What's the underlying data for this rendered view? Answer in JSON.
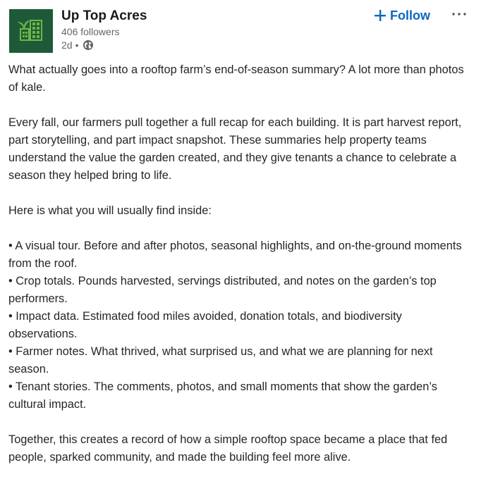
{
  "header": {
    "name": "Up Top Acres",
    "followers": "406 followers",
    "time": "2d",
    "dot": "•",
    "follow_label": "Follow",
    "more_label": "···",
    "logo_icon": "building-garden-logo-icon",
    "visibility_icon": "globe-icon",
    "colors": {
      "logo_bg": "#1e5a3a",
      "logo_fg": "#6fb643",
      "accent": "#0a66c2"
    }
  },
  "post": {
    "intro": "What actually goes into a rooftop farm’s end-of-season summary? A lot more than photos of kale.",
    "para2": "Every fall, our farmers pull together a full recap for each building. It is part harvest report, part storytelling, and part impact snapshot. These summaries help property teams understand the value the garden created, and they give tenants a chance to celebrate a season they helped bring to life.",
    "list_intro": "Here is what you will usually find inside:",
    "bullets": [
      "• A visual tour. Before and after photos, seasonal highlights, and on-the-ground moments from the roof.",
      "• Crop totals. Pounds harvested, servings distributed, and notes on the garden’s top performers.",
      "• Impact data. Estimated food miles avoided, donation totals, and biodiversity observations.",
      "• Farmer notes. What thrived, what surprised us, and what we are planning for next season.",
      "• Tenant stories. The comments, photos, and small moments that show the garden’s cultural impact."
    ],
    "closing": "Together, this creates a record of how a simple rooftop space became a place that fed people, sparked community, and made the building feel more alive."
  }
}
